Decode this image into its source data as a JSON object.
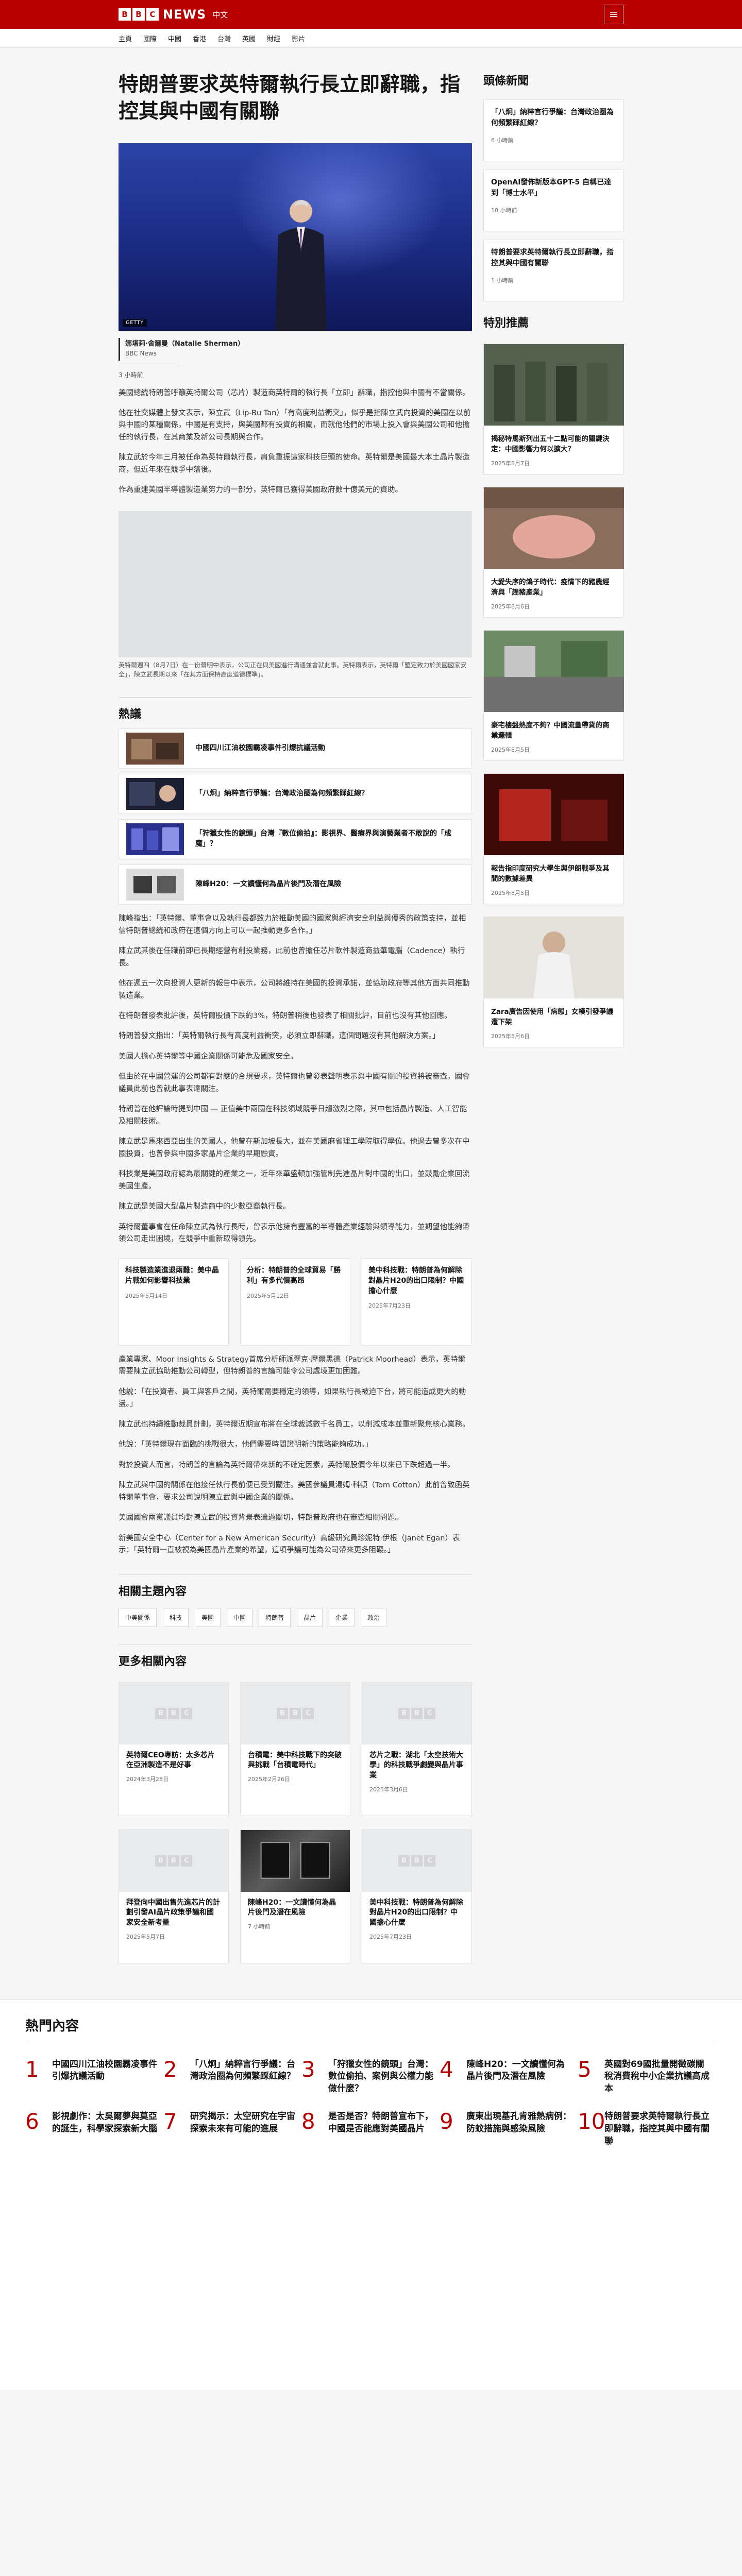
{
  "header": {
    "brand_blocks": [
      "B",
      "B",
      "C"
    ],
    "brand_news": "NEWS",
    "brand_lang": "中文"
  },
  "nav": [
    "主頁",
    "國際",
    "中國",
    "香港",
    "台灣",
    "英國",
    "財經",
    "影片"
  ],
  "article": {
    "headline": "特朗普要求英特爾執行長立即辭職，指控其與中國有關聯",
    "hero_credit": "GETTY",
    "author": "娜塔莉·舍爾曼（Natalie Sherman）",
    "org": "BBC News",
    "date": "3 小時前",
    "paras1": [
      "美國總統特朗普呼籲英特爾公司（芯片）製造商英特爾的執行長「立即」辭職，指控他與中國有不當關係。",
      "他在社交媒體上發文表示，陳立武（Lip-Bu Tan）「有高度利益衝突」，似乎是指陳立武向投資的美國在以前與中國的某種關係，中國是有支持，與美國都有投資的相關，而就他他們的市場上投入會與美國公司和他擔任的執行長，在其商業及新公司長期與合作。",
      "陳立武於今年三月被任命為英特爾執行長，肩負重振這家科技巨頭的使命。英特爾是美國最大本土晶片製造商，但近年來在競爭中落後。",
      "作為重建美國半導體製造業努力的一部分，英特爾已獲得美國政府數十億美元的資助。"
    ],
    "caption": "英特爾週四（8月7日）在一份聲明中表示，公司正在與美國進行溝通並會就此事。英特爾表示，英特爾「堅定致力於美國國家安全」，陳立武長期以來「在其方面保持高度道德標準」。",
    "trending_title": "熱議",
    "trending": [
      "中國四川江油校園霸凌事件引爆抗議活動",
      "「八炯」納粹言行爭議：台灣政治圈為何頻繁踩紅線？",
      "「狩獵女性的鏡頭」台灣『數位偷拍』：影視界、醫療界與演藝業者不敢說的「成魔」？",
      "陳峰H20：一文讀懂何為晶片後門及潛在風險"
    ],
    "paras2": [
      "陳峰指出：「英特爾、董事會以及執行長都致力於推動美國的國家與經濟安全利益與優秀的政策支持，並相信特朗普總統和政府在這個方向上可以一起推動更多合作。」",
      "陳立武其後在任職前即已長期經營有創投業務，此前也曾擔任芯片軟件製造商益華電腦（Cadence）執行長。",
      "他在週五一次向投資人更新的報告中表示，公司將維持在美國的投資承諾，並協助政府等其他方面共同推動製造業。"
    ],
    "paras3": [
      "在特朗普發表批評後，英特爾股價下跌約3%，特朗普稍後也發表了相關批評，目前也沒有其他回應。",
      "特朗普發文指出：「英特爾執行長有高度利益衝突，必須立即辭職。這個問題沒有其他解決方案。」",
      "美國人擔心英特爾等中國企業關係可能危及國家安全。",
      "但由於在中國營運的公司都有對應的合規要求，英特爾也曾發表聲明表示與中國有關的投資將被審查。國會議員此前也曾就此事表達關注。",
      "特朗普在他評論時提到中國 — 正值美中兩國在科技領域競爭日趨激烈之際，其中包括晶片製造、人工智能及相關技術。",
      "陳立武是馬來西亞出生的美國人，他曾在新加坡長大，並在美國麻省理工學院取得學位。他過去曾多次在中國投資，也曾參與中國多家晶片企業的早期融資。",
      "科技業是美國政府認為最關鍵的產業之一，近年來華盛頓加強管制先進晶片對中國的出口，並鼓勵企業回流美國生產。",
      "陳立武是美國大型晶片製造商中的少數亞裔執行長。",
      "英特爾董事會在任命陳立武為執行長時，曾表示他擁有豐富的半導體產業經驗與領導能力，並期望他能夠帶領公司走出困境，在競爭中重新取得領先。"
    ],
    "related3": [
      {
        "title": "科技製造業進退兩難：美中晶片戰如何影響科技業",
        "date": "2025年5月14日"
      },
      {
        "title": "分析：特朗普的全球貿易「勝利」有多代價高昂",
        "date": "2025年5月12日"
      },
      {
        "title": "美中科技戰：特朗普為何解除對晶片H20的出口限制？中國擔心什麼",
        "date": "2025年7月23日"
      }
    ],
    "paras4": [
      "產業專家、Moor Insights & Strategy首席分析師派翠克·摩爾黑德（Patrick Moorhead）表示，英特爾需要陳立武協助推動公司轉型，但特朗普的言論可能令公司處境更加困難。",
      "他說：「在投資者、員工與客戶之間，英特爾需要穩定的領導，如果執行長被迫下台，將可能造成更大的動盪。」",
      "陳立武也持續推動裁員計劃，英特爾近期宣布將在全球裁減數千名員工，以削減成本並重新聚焦核心業務。",
      "他說：「英特爾現在面臨的挑戰很大，他們需要時間證明新的策略能夠成功。」",
      "對於投資人而言，特朗普的言論為英特爾帶來新的不確定因素，英特爾股價今年以來已下跌超過一半。",
      "陳立武與中國的關係在他接任執行長前便已受到關注。美國參議員湯姆·科頓（Tom Cotton）此前曾致函英特爾董事會，要求公司說明陳立武與中國企業的關係。",
      "美國國會兩黨議員均對陳立武的投資背景表達過關切，特朗普政府也在審查相關問題。",
      "新美國安全中心（Center for a New American Security）高級研究員珍妮特·伊根（Janet Egan）表示：「英特爾一直被視為美國晶片產業的希望，這項爭議可能為公司帶來更多阻礙。」"
    ],
    "topics_title": "相關主題內容",
    "topics": [
      "中美關係",
      "科技",
      "美國",
      "中國",
      "特朗普",
      "晶片",
      "企業",
      "政治"
    ],
    "more_title": "更多相關內容",
    "more": [
      {
        "title": "英特爾CEO專訪：太多芯片在亞洲製造不是好事",
        "date": "2024年3月28日",
        "photo": false
      },
      {
        "title": "台積電：美中科技戰下的突破與挑戰「台積電時代」",
        "date": "2025年2月26日",
        "photo": false
      },
      {
        "title": "芯片之戰：湖北「太空技術大學」的科技戰爭劇變與晶片事業",
        "date": "2025年3月6日",
        "photo": false
      },
      {
        "title": "拜登向中國出售先進芯片的計劃引發AI晶片政策爭議和國家安全新考量",
        "date": "2025年5月7日",
        "photo": false
      },
      {
        "title": "陳峰H20：一文讀懂何為晶片後門及潛在風險",
        "date": "7 小時前",
        "photo": true
      },
      {
        "title": "美中科技戰：特朗普為何解除對晶片H20的出口限制？中國擔心什麼",
        "date": "2025年7月23日",
        "photo": false
      }
    ]
  },
  "sidebar": {
    "news_title": "頭條新聞",
    "news": [
      {
        "title": "「八炯」納粹言行爭議：台灣政治圈為何頻繁踩紅線？",
        "time": "6 小時前"
      },
      {
        "title": "OpenAI發佈新版本GPT-5 自稱已達到「博士水平」",
        "time": "10 小時前"
      },
      {
        "title": "特朗普要求英特爾執行長立即辭職，指控其與中國有關聯",
        "time": "1 小時前"
      }
    ],
    "feature_title": "特別推薦",
    "features": [
      {
        "title": "揭秘特馬斯列出五十二點可能的關鍵決定：中國影響力何以擴大？",
        "date": "2025年8月7日",
        "img": "soldiers"
      },
      {
        "title": "大愛失序的鴿子時代：疫情下的豬農經濟與「趕豬產業」",
        "date": "2025年8月6日",
        "img": "pig"
      },
      {
        "title": "豪宅樓盤熱度不夠？中國流量帶貨的商業邏輯",
        "date": "2025年8月5日",
        "img": "street"
      },
      {
        "title": "報告指印度研究大學生與伊朗戰爭及其間的數據差異",
        "date": "2025年8月5日",
        "img": "red"
      },
      {
        "title": "Zara廣告因使用「病態」女模引發爭議遭下架",
        "date": "2025年8月6日",
        "img": "model"
      }
    ]
  },
  "most_read": {
    "title": "熱門內容",
    "items": [
      "中國四川江油校園霸凌事件引爆抗議活動",
      "「八炯」納粹言行爭議：台灣政治圈為何頻繁踩紅線？",
      "「狩獵女性的鏡頭」台灣：數位偷拍、案例與公權力能做什麼？",
      "陳峰H20：一文讀懂何為晶片後門及潛在風險",
      "英國對69國批量開徵碳關稅消費稅中小企業抗議高成本",
      "影視劇作：太吳爾夢與莫亞的誕生，科學家探索新大腦",
      "研究揭示：太空研究在宇宙探索未來有可能的進展",
      "是否是否？特朗普宣布下，中國是否能應對美國晶片",
      "廣東出現基孔肯雅熱病例：防蚊措施與感染風險",
      "特朗普要求英特爾執行長立即辭職，指控其與中國有關聯"
    ]
  },
  "colors": {
    "brand_red": "#b80000",
    "link_blue": "#1a4fa3"
  }
}
